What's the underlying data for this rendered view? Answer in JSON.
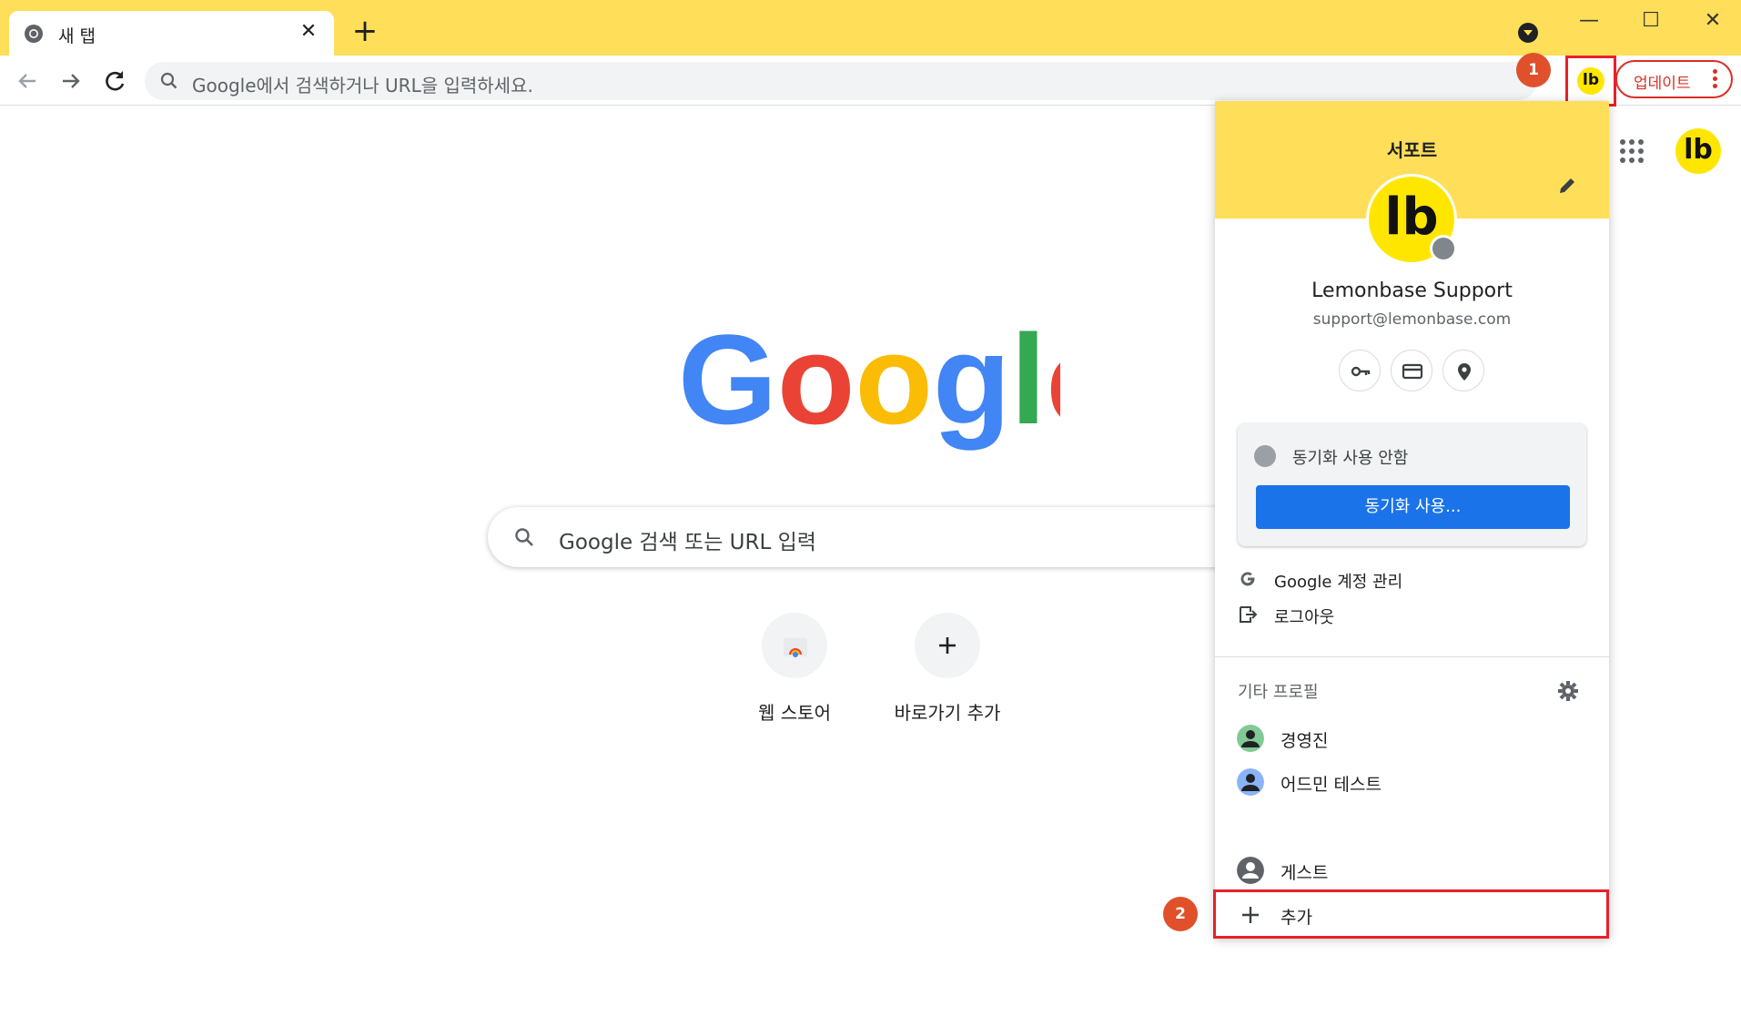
{
  "browser": {
    "tab": {
      "title": "새 탭"
    },
    "omnibox": {
      "placeholder": "Google에서 검색하거나 URL을 입력하세요."
    },
    "profile_button": {
      "initials": "lb"
    },
    "update_button": {
      "label": "업데이트"
    }
  },
  "callouts": {
    "first": "1",
    "second": "2"
  },
  "ntp": {
    "search_placeholder": "Google 검색 또는 URL 입력",
    "shortcuts": [
      {
        "label": "웹 스토어",
        "icon": "chrome-web-store-icon"
      },
      {
        "label": "바로가기 추가",
        "icon": "plus-icon"
      }
    ],
    "avatar_initials": "lb"
  },
  "profile_menu": {
    "title": "서포트",
    "avatar_initials": "lb",
    "name": "Lemonbase Support",
    "email": "support@lemonbase.com",
    "quick_actions": [
      "key-icon",
      "credit-card-icon",
      "location-pin-icon"
    ],
    "sync_status": "동기화 사용 안함",
    "sync_button": "동기화 사용...",
    "account_items": [
      {
        "label": "Google 계정 관리",
        "icon": "google-g-icon"
      },
      {
        "label": "로그아웃",
        "icon": "sign-out-icon"
      }
    ],
    "other_profiles_label": "기타 프로필",
    "other_profiles": [
      {
        "label": "경영진",
        "color": "#34a853"
      },
      {
        "label": "어드민 테스트",
        "color": "#4285f4"
      }
    ],
    "guest_label": "게스트",
    "add_label": "추가"
  },
  "colors": {
    "theme_yellow": "#ffde59",
    "avatar_yellow": "#ffe600",
    "highlight_red": "#e8202a",
    "sync_blue": "#1a73e8"
  }
}
